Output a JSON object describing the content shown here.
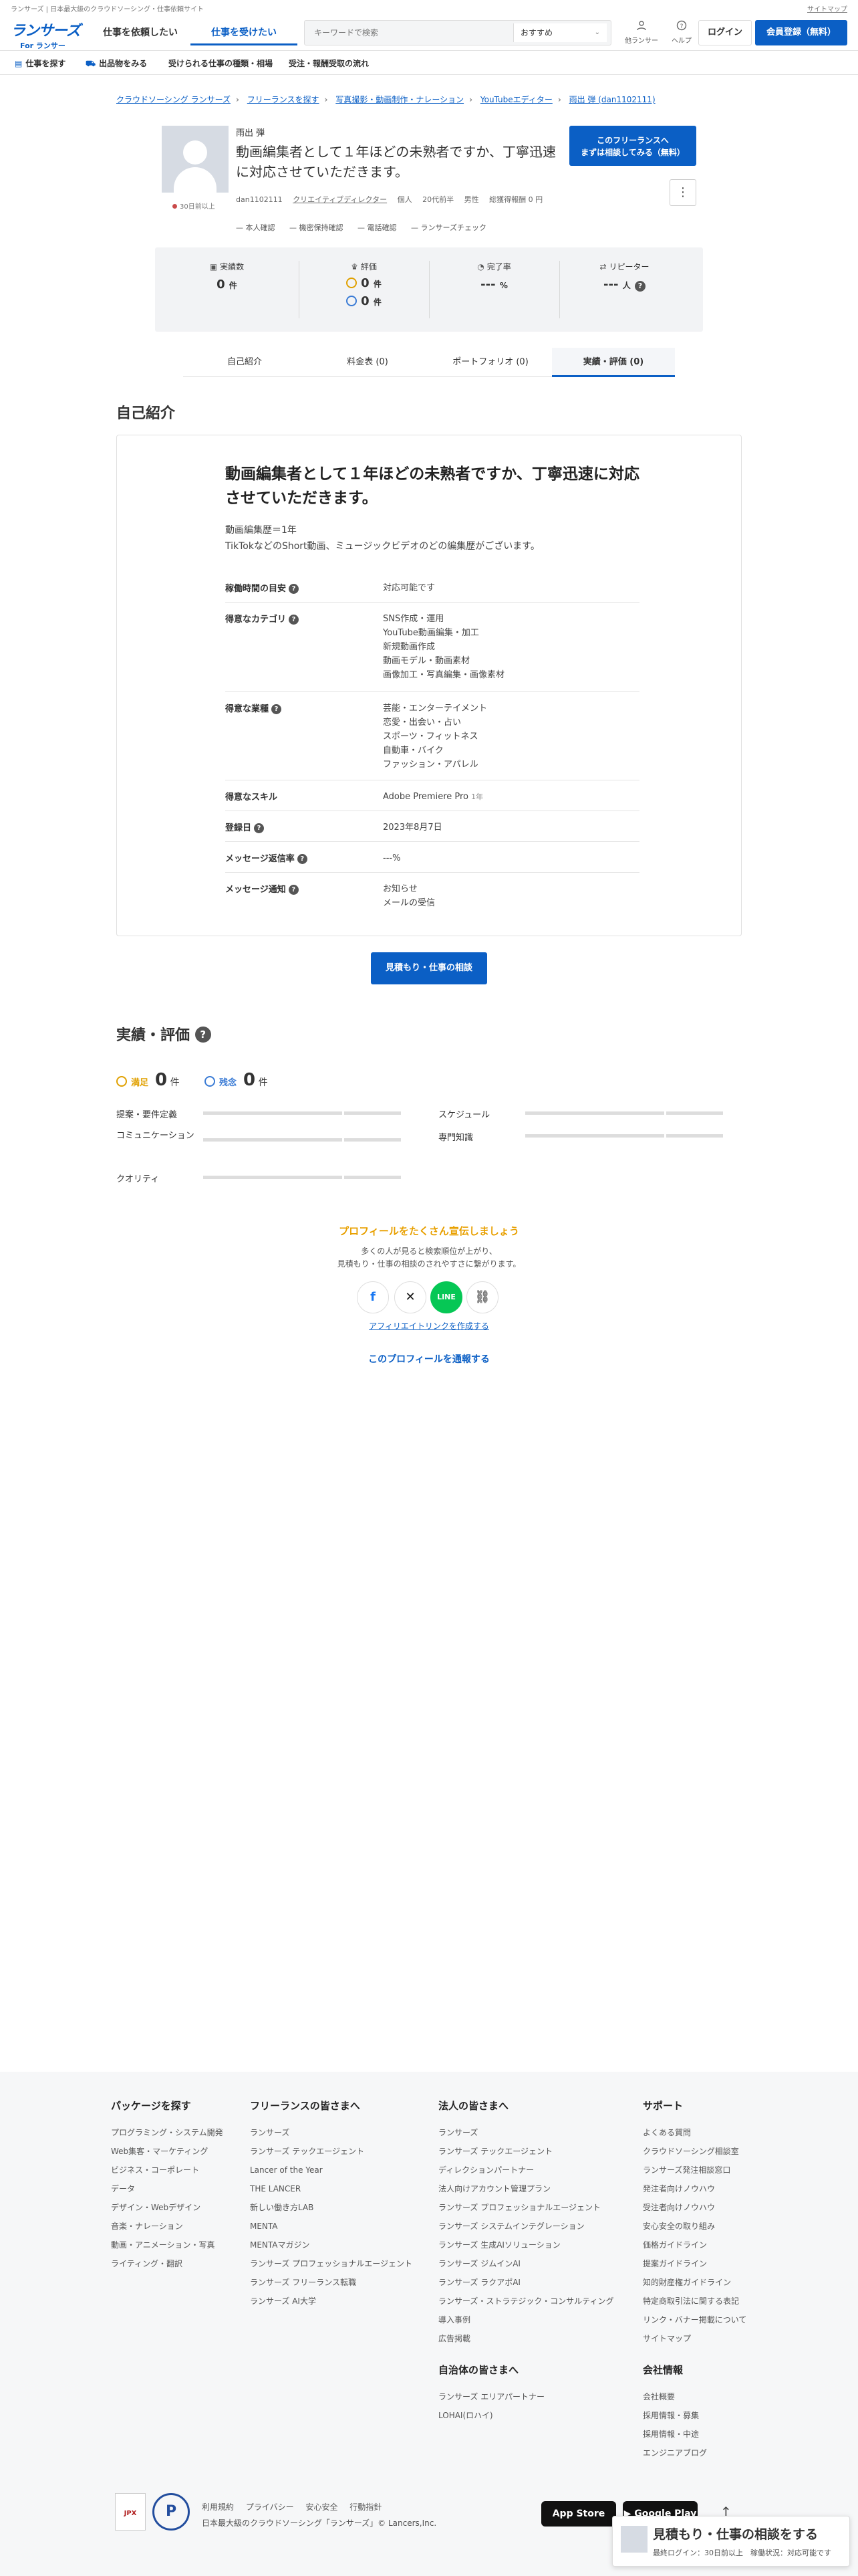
{
  "topbar": {
    "left": "ランサーズ | 日本最大級のクラウドソーシング・仕事依頼サイト",
    "right": "サイトマップ"
  },
  "header": {
    "logo_main": "ランサーズ",
    "logo_sub": "For ランサー",
    "tab_client": "仕事を依頼したい",
    "tab_freelance": "仕事を受けたい",
    "search_placeholder": "キーワードで検索",
    "search_sort": "おすすめ",
    "lancer_search": "他ランサー",
    "help": "ヘルプ",
    "login": "ログイン",
    "register": "会員登録（無料）"
  },
  "subnav": {
    "find_jobs": "仕事を探す",
    "view_products": "出品物をみる",
    "job_types": "受けられる仕事の種類・相場",
    "flow": "受注・報酬受取の流れ"
  },
  "breadcrumb": [
    "クラウドソーシング ランサーズ",
    "フリーランスを探す",
    "写真撮影・動画制作・ナレーション",
    "YouTubeエディター",
    "雨出 弾 (dan1102111)"
  ],
  "profile": {
    "name": "雨出 弾",
    "headline": "動画編集者として１年ほどの未熟者ですか、丁寧迅速に対応させていただきます。",
    "online": "30日前以上",
    "user_id": "dan1102111",
    "job": "クリエイティブディレクター",
    "type": "個人",
    "age": "20代前半",
    "gender": "男性",
    "earnings": "総獲得報酬 0 円",
    "verifications": [
      "本人確認",
      "機密保持確認",
      "電話確認",
      "ランサーズチェック"
    ],
    "consult_btn_line1": "このフリーランスへ",
    "consult_btn_line2": "まずは相談してみる（無料）",
    "menu_icon": "⋮"
  },
  "stats": {
    "record_label": "実績数",
    "record_value": "0",
    "record_unit": "件",
    "rating_label": "評価",
    "rating_good": "0",
    "rating_bad": "0",
    "rating_unit": "件",
    "completion_label": "完了率",
    "completion_value": "---",
    "completion_unit": "%",
    "repeater_label": "リピーター",
    "repeater_value": "---",
    "repeater_unit": "人"
  },
  "tabs": [
    "自己紹介",
    "料金表 (0)",
    "ポートフォリオ (0)",
    "実績・評価 (0)"
  ],
  "intro": {
    "section_title": "自己紹介",
    "headline": "動画編集者として１年ほどの未熟者ですか、丁寧迅速に対応させていただきます。",
    "body_1": "動画編集歴＝1年",
    "body_2": "TikTokなどのShort動画、ミュージックビデオのどの編集歴がございます。",
    "rows": [
      {
        "key": "稼働時間の目安",
        "values": [
          "対応可能です"
        ]
      },
      {
        "key": "得意なカテゴリ",
        "values": [
          "SNS作成・運用",
          "YouTube動画編集・加工",
          "新規動画作成",
          "動画モデル・動画素材",
          "画像加工・写真編集・画像素材"
        ]
      },
      {
        "key": "得意な業種",
        "values": [
          "芸能・エンターテイメント",
          "恋愛・出会い・占い",
          "スポーツ・フィットネス",
          "自動車・バイク",
          "ファッション・アパレル"
        ]
      },
      {
        "key": "得意なスキル",
        "values": [
          "Adobe Premiere Pro"
        ],
        "note": "1年"
      },
      {
        "key": "登録日",
        "values": [
          "2023年8月7日"
        ]
      },
      {
        "key": "メッセージ返信率",
        "values": [
          "---%"
        ]
      },
      {
        "key": "メッセージ通知",
        "values": [
          "お知らせ",
          "メールの受信"
        ]
      }
    ]
  },
  "quote_button": "見積もり・仕事の相談",
  "results": {
    "section_title": "実績・評価",
    "good_label": "満足",
    "good_count": "0",
    "bad_label": "残念",
    "bad_count": "0",
    "unit": "件",
    "metrics_left": [
      "提案・要件定義",
      "コミュニケーション",
      "クオリティ"
    ],
    "metrics_right": [
      "スケジュール",
      "専門知識"
    ]
  },
  "share": {
    "title": "プロフィールをたくさん宣伝しましょう",
    "text_1": "多くの人が見ると検索順位が上がり、",
    "text_2": "見積もり・仕事の相談のされやすさに繋がります。",
    "affiliate": "アフィリエイトリンクを作成する",
    "report": "このプロフィールを通報する"
  },
  "footer": {
    "col1_title": "パッケージを探す",
    "col1": [
      "プログラミング・システム開発",
      "Web集客・マーケティング",
      "ビジネス・コーポレート",
      "データ",
      "デザイン・Webデザイン",
      "音楽・ナレーション",
      "動画・アニメーション・写真",
      "ライティング・翻訳"
    ],
    "col2_title": "フリーランスの皆さまへ",
    "col2": [
      "ランサーズ",
      "ランサーズ テックエージェント",
      "Lancer of the Year",
      "THE LANCER",
      "新しい働き方LAB",
      "MENTA",
      "MENTAマガジン",
      "ランサーズ プロフェッショナルエージェント",
      "ランサーズ フリーランス転職",
      "ランサーズ AI大学"
    ],
    "col3_title": "法人の皆さまへ",
    "col3": [
      "ランサーズ",
      "ランサーズ テックエージェント",
      "ディレクションパートナー",
      "法人向けアカウント管理プラン",
      "ランサーズ プロフェッショナルエージェント",
      "ランサーズ システムインテグレーション",
      "ランサーズ 生成AIソリューション",
      "ランサーズ ジムインAI",
      "ランサーズ ラクアポAI",
      "ランサーズ・ストラテジック・コンサルティング",
      "導入事例",
      "広告掲載"
    ],
    "col3b_title": "自治体の皆さまへ",
    "col3b": [
      "ランサーズ エリアパートナー",
      "LOHAI(ロハイ)"
    ],
    "col4_title": "サポート",
    "col4": [
      "よくある質問",
      "クラウドソーシング相談室",
      "ランサーズ発注相談窓口",
      "発注者向けノウハウ",
      "受注者向けノウハウ",
      "安心安全の取り組み",
      "価格ガイドライン",
      "提案ガイドライン",
      "知的財産権ガイドライン",
      "特定商取引法に関する表記",
      "リンク・バナー掲載について",
      "サイトマップ"
    ],
    "col4b_title": "会社情報",
    "col4b": [
      "会社概要",
      "採用情報・募集",
      "採用情報・中途",
      "エンジニアブログ"
    ],
    "links": [
      "利用規約",
      "プライバシー",
      "安心安全",
      "行動指針"
    ],
    "copyright": "日本最大級のクラウドソーシング「ランサーズ」© Lancers,Inc.",
    "jpx": "JPX",
    "appstore": "App Store",
    "googleplay": "Google Play"
  },
  "float_cta": {
    "title": "見積もり・仕事の相談をする",
    "sub": "最終ログイン：30日前以上　稼働状況：対応可能です"
  }
}
